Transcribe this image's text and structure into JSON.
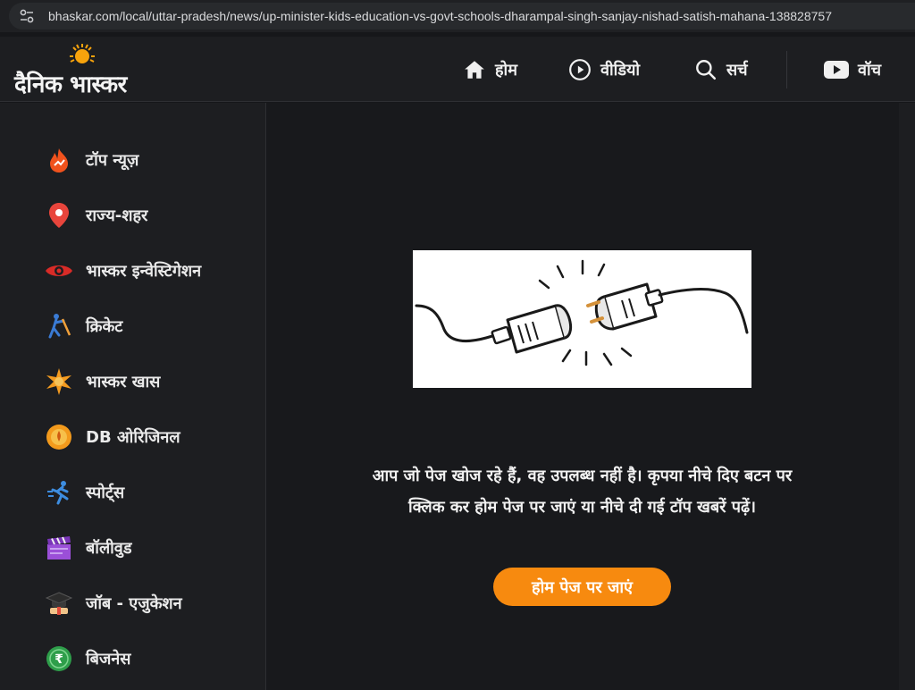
{
  "browser": {
    "url": "bhaskar.com/local/uttar-pradesh/news/up-minister-kids-education-vs-govt-schools-dharampal-singh-sanjay-nishad-satish-mahana-138828757"
  },
  "header": {
    "logo_text": "दैनिक भास्कर",
    "nav": [
      {
        "label": "होम",
        "icon": "home-icon"
      },
      {
        "label": "वीडियो",
        "icon": "play-circle-icon"
      },
      {
        "label": "सर्च",
        "icon": "search-icon"
      },
      {
        "label": "वॉच",
        "icon": "youtube-icon"
      }
    ]
  },
  "sidebar": {
    "items": [
      {
        "label": "टॉप न्यूज़",
        "icon": "fire-icon"
      },
      {
        "label": "राज्य-शहर",
        "icon": "location-pin-icon"
      },
      {
        "label": "भास्कर इन्वेस्टिगेशन",
        "icon": "eye-icon"
      },
      {
        "label": "क्रिकेट",
        "icon": "cricket-icon"
      },
      {
        "label": "भास्कर खास",
        "icon": "star-burst-icon"
      },
      {
        "label": "DB ओरिजिनल",
        "icon": "db-original-icon"
      },
      {
        "label": "स्पोर्ट्स",
        "icon": "runner-icon"
      },
      {
        "label": "बॉलीवुड",
        "icon": "clapperboard-icon"
      },
      {
        "label": "जॉब - एजुकेशन",
        "icon": "graduation-cap-icon"
      },
      {
        "label": "बिजनेस",
        "icon": "rupee-icon"
      }
    ]
  },
  "main": {
    "message": "आप जो पेज खोज रहे हैं, वह उपलब्ध नहीं है। कृपया नीचे दिए बटन पर क्लिक कर होम पेज पर जाएं या नीचे दी गई टॉप खबरें पढ़ें।",
    "home_button": "होम पेज पर जाएं",
    "illustration": "unplugged-cable-illustration"
  },
  "colors": {
    "accent": "#f78a0f",
    "background": "#18191c",
    "sidebar": "#1d1e21"
  }
}
